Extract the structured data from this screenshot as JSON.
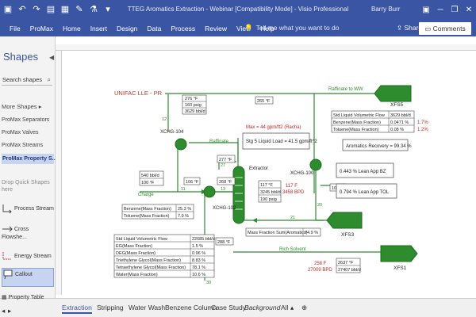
{
  "window": {
    "title": "TTEG Aromatics Extraction - Webinar  [Compatibility Mode]  -  Visio Professional",
    "user": "Barry Burr"
  },
  "menu": {
    "tabs": [
      "File",
      "ProMax",
      "Home",
      "Insert",
      "Design",
      "Data",
      "Process",
      "Review",
      "View",
      "Help"
    ],
    "tell_me": "Tell me what you want to do",
    "share": "Share",
    "comments": "Comments"
  },
  "shapes_pane": {
    "title": "Shapes",
    "search_placeholder": "Search shapes",
    "more_shapes": "More Shapes",
    "stencils": [
      "ProMax Separators",
      "ProMax Valves",
      "ProMax Streams",
      "ProMax Property S..."
    ],
    "drop_hint": "Drop Quick Shapes here",
    "shapes": [
      "Process Stream",
      "Cross Flowshe...",
      "Energy Stream",
      "Callout",
      "Property Table"
    ]
  },
  "page_tabs": [
    "Extraction",
    "Stripping",
    "Water Wash",
    "Benzene Column",
    "Case Study",
    "Background",
    "All"
  ],
  "diagram": {
    "package_label": "UNIFAC LLE - PR",
    "max_label": "Max = 44 gpm/ft2 (Racha)",
    "stg_label": "Stg 5 Liquid Load = 41.5 gpm/ft^2",
    "raffinate_label": "Raffinate",
    "raffinate_to_ww": "Raffinate to WW",
    "charge": "Charge",
    "rich_solvent": "Rich Solvent",
    "extractor": "Extractor",
    "xchg104": "XCHG-104",
    "xchg102": "XCHG-102",
    "xchg100": "XCHG-100",
    "xfs5": "XFS5",
    "xfs3": "XFS3",
    "xfs1": "XFS1",
    "stream_numbers": [
      "11",
      "12",
      "13",
      "14",
      "20",
      "21",
      "27",
      "28",
      "30"
    ],
    "top_table": [
      "276 °F",
      "160 psig",
      "3629 bbl/d"
    ],
    "t265": "265 °F",
    "t277": "277 °F",
    "t268": "268 °F",
    "t106": "106 °F",
    "t101": "101 °F",
    "t288": "288 °F",
    "feed_table": [
      "540 bbl/d",
      "100 °F"
    ],
    "mid_table": [
      "117 °F",
      "3245 bbl/d",
      "190 psig"
    ],
    "red_117": "117 F",
    "red_3458": "3458 BPD",
    "red_258": "258 F",
    "red_27009": "27009 BPD",
    "t2637": "2637 °F",
    "t27407": "27407 bbl/d",
    "comp_small": [
      {
        "label": "Benzene(Mass Fraction)",
        "value": "25.3 %"
      },
      {
        "label": "Toluene(Mass Fraction)",
        "value": "7.9 %"
      }
    ],
    "mass_sum": {
      "label": "Mass Fraction Sum(Aromatics)",
      "value": "74.9 %"
    },
    "raff_table": [
      {
        "label": "Std Liquid Volumetric Flow",
        "value": "3629 bbl/d",
        "red": ""
      },
      {
        "label": "Benzene(Mass Fraction)",
        "value": "0.0471 %",
        "red": "1.7%"
      },
      {
        "label": "Toluene(Mass Fraction)",
        "value": "0.08 %",
        "red": "1.2%"
      }
    ],
    "aromatics_recovery": "Aromatics Recovery = 99.34 %",
    "lean_bz": "0.443 % Lean App BZ",
    "lean_tol": "0.794 % Lean App TOL",
    "solvent_table": [
      {
        "label": "Std Liquid Volumetric Flow",
        "value": "22685 bbl/d"
      },
      {
        "label": "EG(Mass Fraction)",
        "value": "1.5 %"
      },
      {
        "label": "DEG(Mass Fraction)",
        "value": "0.96 %"
      },
      {
        "label": "Triethylene Glycol(Mass Fraction)",
        "value": "8.83 %"
      },
      {
        "label": "Tetraethylene Glycol(Mass Fraction)",
        "value": "78.1 %"
      },
      {
        "label": "Water(Mass Fraction)",
        "value": "10.6 %"
      }
    ]
  },
  "colors": {
    "accent": "#3955a3",
    "stream": "#2e8b2e",
    "red_text": "#cc2222",
    "package_red": "#c0392b"
  }
}
